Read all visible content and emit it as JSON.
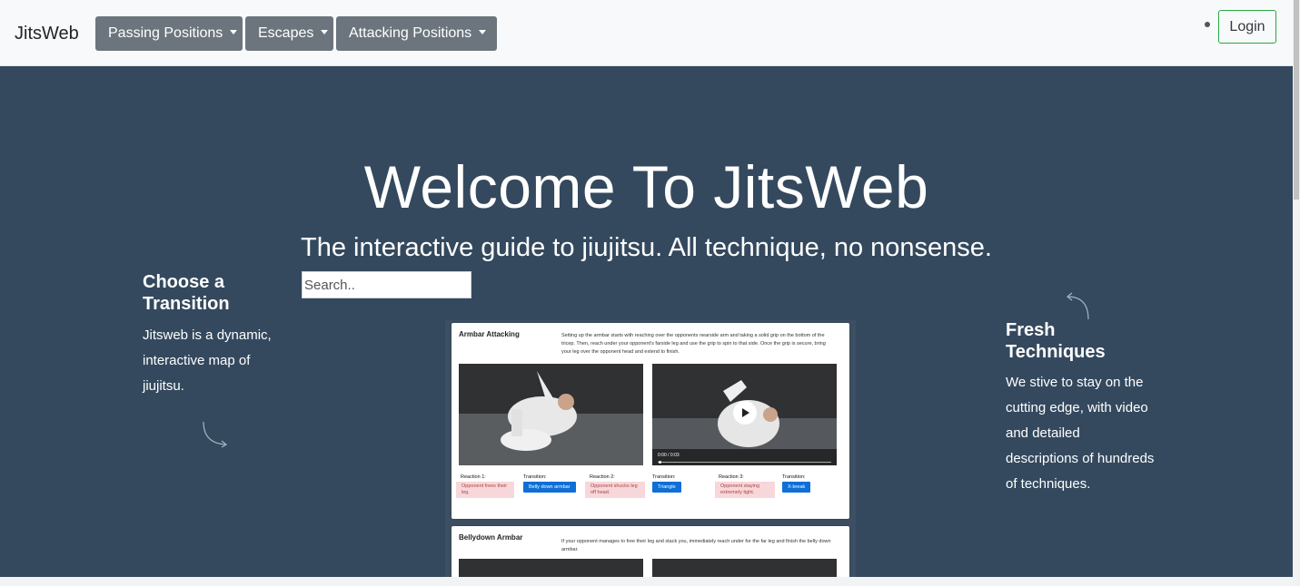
{
  "navbar": {
    "brand": "JitsWeb",
    "menus": [
      {
        "label": "Passing Positions"
      },
      {
        "label": "Escapes"
      },
      {
        "label": "Attacking Positions"
      }
    ],
    "login_label": "Login"
  },
  "hero": {
    "title": "Welcome To JitsWeb",
    "subtitle": "The interactive guide to jiujitsu. All technique, no nonsense.",
    "search_placeholder": "Search..",
    "left_feature": {
      "heading": "Choose a Transition",
      "text": "Jitsweb is a dynamic, interactive map of jiujitsu."
    },
    "right_feature": {
      "heading": "Fresh Techniques",
      "text": "We stive to stay on the cutting edge, with video and detailed descriptions of hundreds of techniques."
    }
  },
  "preview": {
    "card1": {
      "title": "Armbar Attacking",
      "description": "Setting up the armbar starts with reaching over the opponents nearside arm and taking a solid grip on the bottom of the tricep. Then, reach under your opponent's farside leg and use the grip to spin to that side. Once the grip is secure, bring your leg over the opponent head and extend to finish.",
      "video_time": "0:00 / 0:03",
      "reactions": [
        {
          "label": "Reaction 1:",
          "text": "Opponent frees their leg.",
          "transition_label": "Transition:",
          "transition": "Belly down armbar"
        },
        {
          "label": "Reaction 2:",
          "text": "Opponent shucks leg off head.",
          "transition_label": "Transition:",
          "transition": "Triangle"
        },
        {
          "label": "Reaction 3:",
          "text": "Opponent staying extremely tight.",
          "transition_label": "Transition:",
          "transition": "X-break"
        }
      ]
    },
    "card2": {
      "title": "Bellydown Armbar",
      "description": "If your opponent manages to free their leg and stack you, immediately reach under for the far leg and finish the belly down armbar."
    }
  },
  "colors": {
    "hero_bg": "#34495e",
    "nav_button": "#6c757d",
    "login_border": "#28a745",
    "transition_button": "#0f6fd6",
    "reaction_bg": "#f8d7da"
  },
  "icons": [
    "caret-down-icon",
    "curved-arrow-down-icon",
    "curved-arrow-up-icon",
    "play-icon"
  ]
}
